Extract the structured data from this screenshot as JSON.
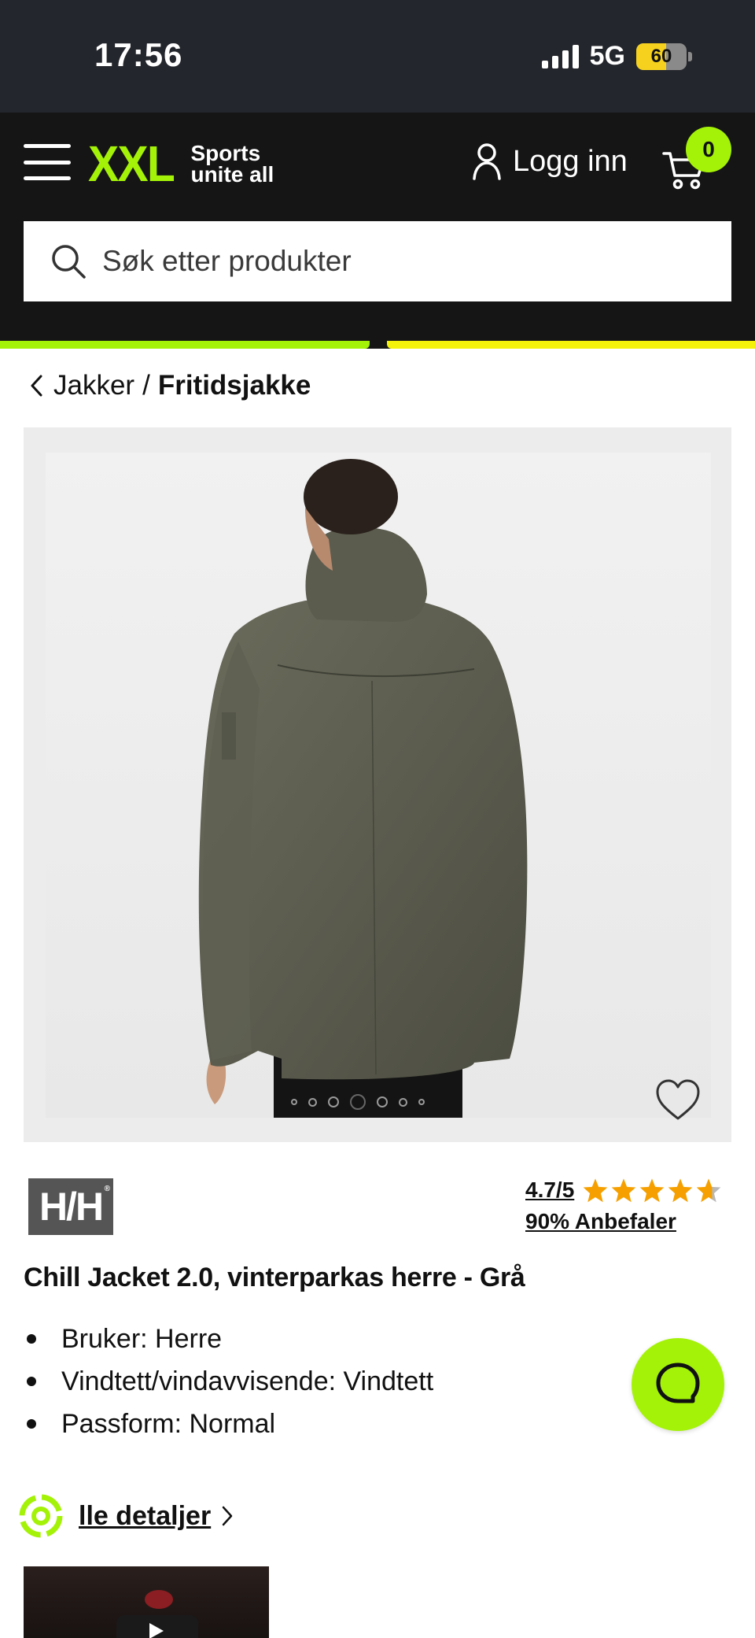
{
  "status_bar": {
    "time": "17:56",
    "network": "5G",
    "battery": "60",
    "battery_level": 0.6
  },
  "header": {
    "logo": "XXL",
    "logo_tagline_1": "Sports",
    "logo_tagline_2": "unite all",
    "login_label": "Logg inn",
    "cart_count": "0",
    "search_placeholder": "Søk etter produkter"
  },
  "breadcrumb": {
    "parent": "Jakker",
    "separator": "/",
    "current": "Fritidsjakke"
  },
  "gallery": {
    "image_count": 7,
    "active_index": 3
  },
  "product": {
    "brand": "H/H",
    "rating": "4.7/5",
    "rating_value": 4.7,
    "recommend": "90% Anbefaler",
    "title": "Chill Jacket 2.0, vinterparkas herre - Grå",
    "features": [
      "Bruker: Herre",
      "Vindtett/vindavvisende: Vindtett",
      "Passform: Normal"
    ],
    "details_link": "lle detaljer"
  },
  "colors": {
    "brand_green": "#a4f207",
    "brand_yellow": "#f4f20b",
    "header_bg": "#151515",
    "star": "#f5a000"
  }
}
